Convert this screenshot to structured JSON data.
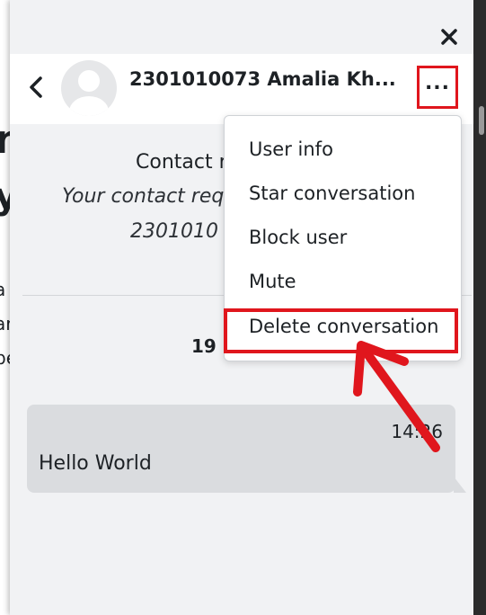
{
  "background_page": {
    "fragments": [
      "n",
      "y",
      "a",
      "ar",
      "be"
    ]
  },
  "drawer": {
    "close_icon": "close-icon",
    "header": {
      "back_icon": "chevron-left-icon",
      "avatar_icon": "user-avatar-icon",
      "contact_name": "2301010073 Amalia Kh...",
      "menu_icon": "more-horizontal-icon",
      "menu_label": "..."
    },
    "request": {
      "title": "Contact r",
      "text": "Your contact req",
      "id_fragment": "2301010"
    },
    "date_label": "19",
    "message": {
      "time": "14:26",
      "text": "Hello World"
    },
    "menu": {
      "items": [
        {
          "label": "User info"
        },
        {
          "label": "Star conversation"
        },
        {
          "label": "Block user"
        },
        {
          "label": "Mute"
        },
        {
          "label": "Delete conversation"
        }
      ]
    }
  },
  "annotations": {
    "highlight_color": "#e0161d",
    "arrow_icon": "pointer-arrow-icon"
  }
}
